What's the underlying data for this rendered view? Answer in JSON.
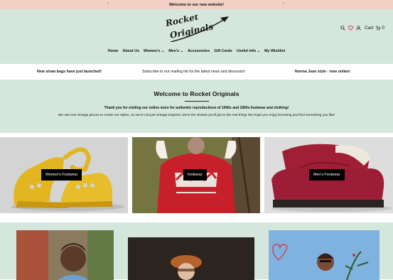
{
  "announcement": {
    "text": "Welcome to our new website!"
  },
  "header": {
    "cart_label": "Cart",
    "cart_count": "0"
  },
  "nav": {
    "items": [
      "Home",
      "About Us",
      "Women's",
      "Men's",
      "Accessories",
      "Gift Cards",
      "Useful info",
      "My Wishlist"
    ]
  },
  "strip": {
    "messages": [
      "New straw bags have just launched!",
      "Subscribe to our mailing list for the latest news and discounts!",
      "Norma Jean style - now online!"
    ]
  },
  "welcome": {
    "title": "Welcome to Rocket Originals",
    "subtitle": "Thank you for visiting our online store for authentic reproductions of 1940s and 1950s footwear and clothing!",
    "body": "We use true vintage pieces to create our styles, so we're not just vintage inspired, we're the closest you'll get to the real thing! We hope you enjoy browsing and find something you like!"
  },
  "categories": {
    "labels": [
      "Women's Footwear",
      "Knitwear",
      "Men's Footwear"
    ]
  },
  "colors": {
    "mint": "#d5e6dd",
    "peach": "#f2d0c4",
    "accent_red": "#d8334a"
  }
}
